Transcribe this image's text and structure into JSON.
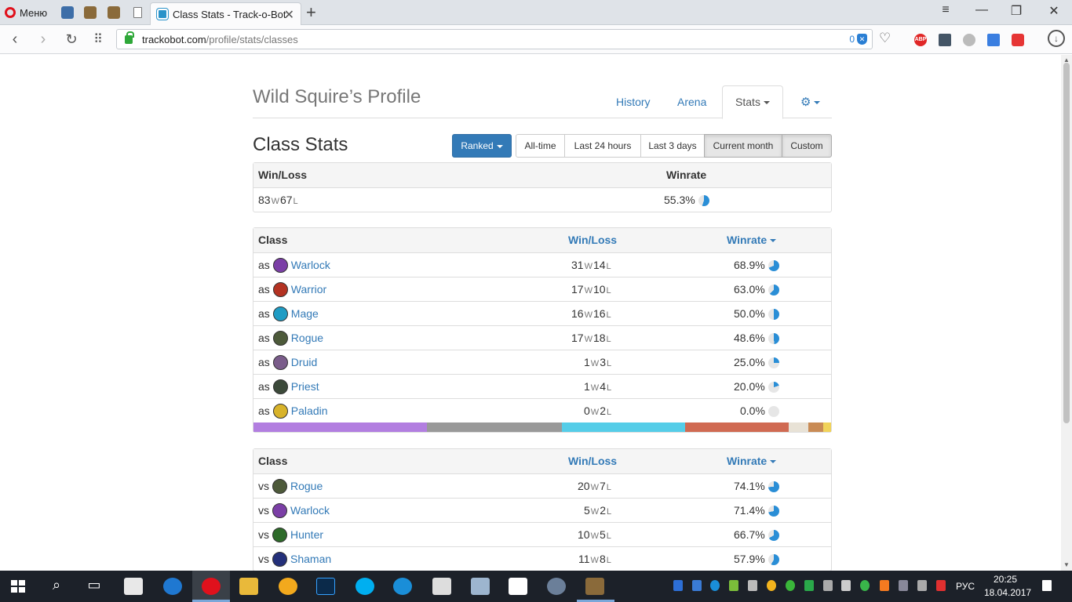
{
  "browser": {
    "menu_label": "Меню",
    "tab_title": "Class Stats - Track-o-Bot",
    "url_host": "trackobot.com",
    "url_path": "/profile/stats/classes",
    "blocked_count": "0",
    "ext_abp": "ABP"
  },
  "header": {
    "profile_title": "Wild Squire’s Profile",
    "nav": {
      "history": "History",
      "arena": "Arena",
      "stats": "Stats"
    }
  },
  "toolbar": {
    "title": "Class Stats",
    "mode": "Ranked",
    "ranges": [
      "All-time",
      "Last 24 hours",
      "Last 3 days",
      "Current month",
      "Custom"
    ],
    "active_ranges": [
      "Current month",
      "Custom"
    ]
  },
  "overall": {
    "headers": {
      "winloss": "Win/Loss",
      "winrate": "Winrate"
    },
    "wins": "83",
    "losses": "67",
    "winrate": "55.3%",
    "winrate_value": 55.3
  },
  "labels": {
    "w": "W",
    "l": "L",
    "as": "as",
    "vs": "vs"
  },
  "as_table": {
    "headers": {
      "class": "Class",
      "winloss": "Win/Loss",
      "winrate": "Winrate"
    },
    "rows": [
      {
        "name": "Warlock",
        "wins": "31",
        "losses": "14",
        "winrate": "68.9%",
        "rate": 68.9,
        "icon": "warlock-icon",
        "color": "#7b3fa6"
      },
      {
        "name": "Warrior",
        "wins": "17",
        "losses": "10",
        "winrate": "63.0%",
        "rate": 63.0,
        "icon": "warrior-icon",
        "color": "#b43222"
      },
      {
        "name": "Mage",
        "wins": "16",
        "losses": "16",
        "winrate": "50.0%",
        "rate": 50.0,
        "icon": "mage-icon",
        "color": "#1f9cc4"
      },
      {
        "name": "Rogue",
        "wins": "17",
        "losses": "18",
        "winrate": "48.6%",
        "rate": 48.6,
        "icon": "rogue-icon",
        "color": "#4d5a3a"
      },
      {
        "name": "Druid",
        "wins": "1",
        "losses": "3",
        "winrate": "25.0%",
        "rate": 25.0,
        "icon": "druid-icon",
        "color": "#7a5c8a"
      },
      {
        "name": "Priest",
        "wins": "1",
        "losses": "4",
        "winrate": "20.0%",
        "rate": 20.0,
        "icon": "priest-icon",
        "color": "#3c4a3a"
      },
      {
        "name": "Paladin",
        "wins": "0",
        "losses": "2",
        "winrate": "0.0%",
        "rate": 0.0,
        "icon": "paladin-icon",
        "color": "#d8b32a"
      }
    ],
    "distribution": [
      {
        "share": 45,
        "color": "#b27ee0"
      },
      {
        "share": 35,
        "color": "#999999"
      },
      {
        "share": 32,
        "color": "#55cde8"
      },
      {
        "share": 27,
        "color": "#d06a52"
      },
      {
        "share": 5,
        "color": "#e8e2d6"
      },
      {
        "share": 4,
        "color": "#c98b55"
      },
      {
        "share": 2,
        "color": "#f1d35a"
      }
    ]
  },
  "vs_table": {
    "headers": {
      "class": "Class",
      "winloss": "Win/Loss",
      "winrate": "Winrate"
    },
    "rows": [
      {
        "name": "Rogue",
        "wins": "20",
        "losses": "7",
        "winrate": "74.1%",
        "rate": 74.1,
        "icon": "rogue-icon",
        "color": "#4d5a3a"
      },
      {
        "name": "Warlock",
        "wins": "5",
        "losses": "2",
        "winrate": "71.4%",
        "rate": 71.4,
        "icon": "warlock-icon",
        "color": "#7b3fa6"
      },
      {
        "name": "Hunter",
        "wins": "10",
        "losses": "5",
        "winrate": "66.7%",
        "rate": 66.7,
        "icon": "hunter-icon",
        "color": "#2e6b2a"
      },
      {
        "name": "Shaman",
        "wins": "11",
        "losses": "8",
        "winrate": "57.9%",
        "rate": 57.9,
        "icon": "shaman-icon",
        "color": "#24307a"
      }
    ]
  },
  "taskbar": {
    "lang": "РУС",
    "time": "20:25",
    "date": "18.04.2017"
  },
  "colors": {
    "accent": "#337ab7",
    "pie_fill": "#2a8ed6",
    "pie_bg": "#e6e6e6"
  }
}
